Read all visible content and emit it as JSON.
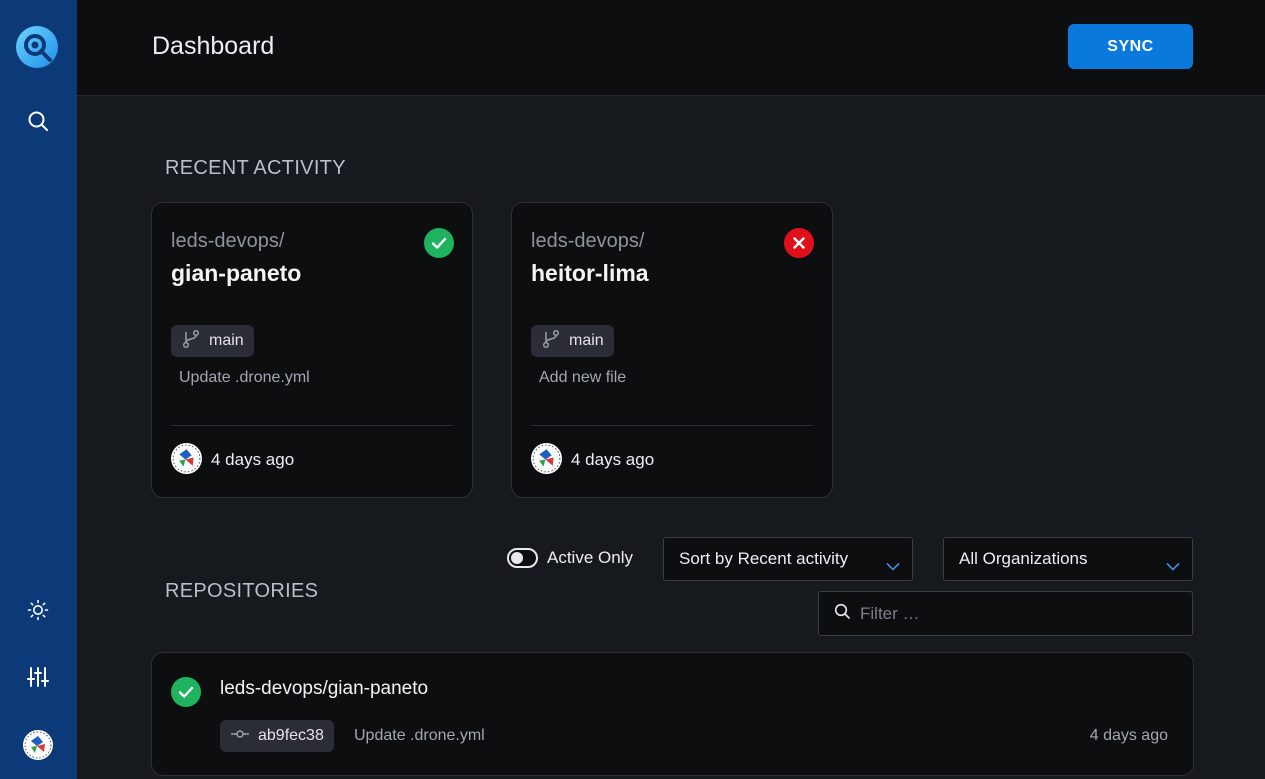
{
  "header": {
    "title": "Dashboard",
    "sync_label": "SYNC"
  },
  "sidebar": {
    "logo_icon": "drone-logo-icon",
    "items": [
      {
        "icon": "search-icon"
      },
      {
        "icon": "sun-icon"
      },
      {
        "icon": "sliders-icon"
      },
      {
        "icon": "user-avatar"
      }
    ]
  },
  "recent": {
    "title": "RECENT ACTIVITY",
    "cards": [
      {
        "owner": "leds-devops/",
        "repo": "gian-paneto",
        "status": "success",
        "branch": "main",
        "message": "Update .drone.yml",
        "time": "4 days ago"
      },
      {
        "owner": "leds-devops/",
        "repo": "heitor-lima",
        "status": "failure",
        "branch": "main",
        "message": "Add new file",
        "time": "4 days ago"
      }
    ]
  },
  "repositories": {
    "title": "REPOSITORIES",
    "active_only_label": "Active Only",
    "active_only": false,
    "sort_selected": "Sort by Recent activity",
    "org_selected": "All Organizations",
    "filter_placeholder": "Filter …",
    "items": [
      {
        "name": "leds-devops/gian-paneto",
        "status": "success",
        "commit": "ab9fec38",
        "message": "Update .drone.yml",
        "time": "4 days ago"
      }
    ]
  },
  "colors": {
    "sidebar": "#0c3a78",
    "accent": "#0a79dc",
    "success": "#1fb35f",
    "failure": "#e0101b"
  }
}
